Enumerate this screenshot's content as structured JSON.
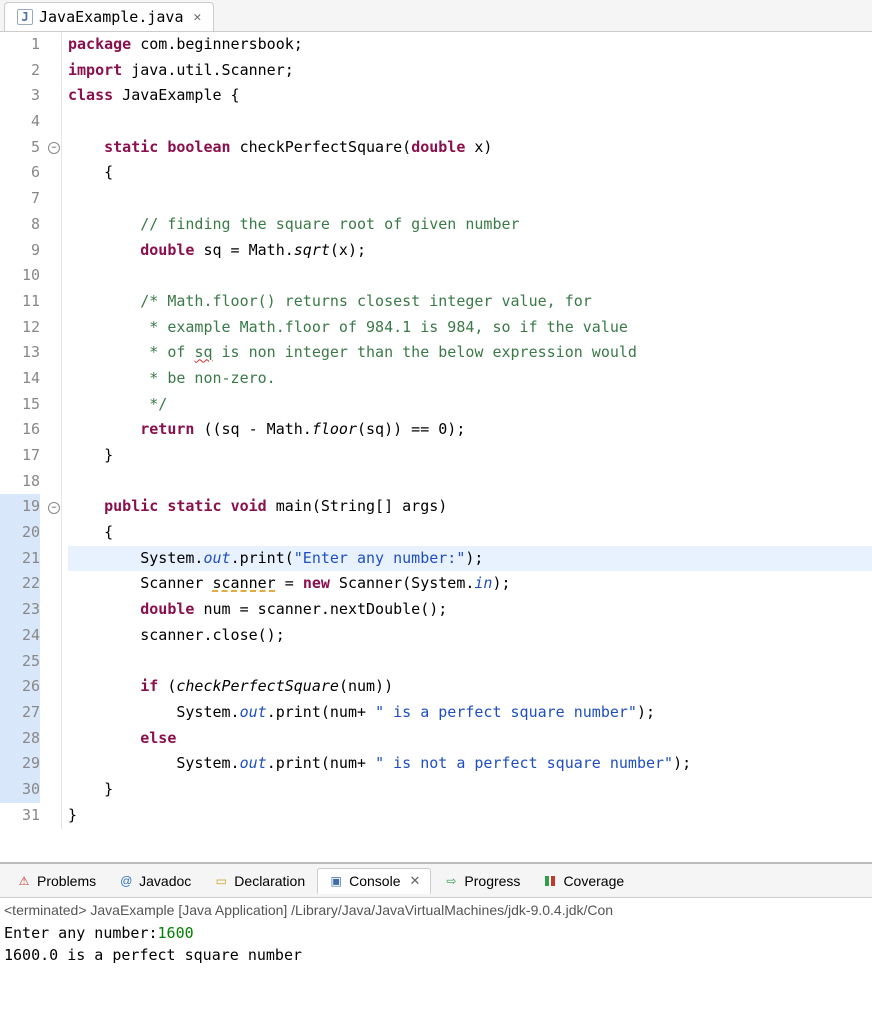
{
  "tab": {
    "filename": "JavaExample.java"
  },
  "code": {
    "lines": [
      {
        "n": 1,
        "tokens": [
          [
            "kw",
            "package"
          ],
          [
            "",
            " com.beginnersbook;"
          ]
        ]
      },
      {
        "n": 2,
        "tokens": [
          [
            "kw",
            "import"
          ],
          [
            "",
            " java.util.Scanner;"
          ]
        ]
      },
      {
        "n": 3,
        "tokens": [
          [
            "kw",
            "class"
          ],
          [
            "",
            " JavaExample {"
          ]
        ]
      },
      {
        "n": 4,
        "tokens": [
          [
            "",
            ""
          ]
        ]
      },
      {
        "n": 5,
        "fold": true,
        "tokens": [
          [
            "",
            "    "
          ],
          [
            "kw",
            "static"
          ],
          [
            "",
            " "
          ],
          [
            "kw",
            "boolean"
          ],
          [
            "",
            " checkPerfectSquare("
          ],
          [
            "kw",
            "double"
          ],
          [
            "",
            " x)"
          ]
        ]
      },
      {
        "n": 6,
        "tokens": [
          [
            "",
            "    {"
          ]
        ]
      },
      {
        "n": 7,
        "tokens": [
          [
            "",
            ""
          ]
        ]
      },
      {
        "n": 8,
        "tokens": [
          [
            "",
            "        "
          ],
          [
            "comment",
            "// finding the square root of given number"
          ]
        ]
      },
      {
        "n": 9,
        "tokens": [
          [
            "",
            "        "
          ],
          [
            "kw",
            "double"
          ],
          [
            "",
            " sq = Math."
          ],
          [
            "method-ital",
            "sqrt"
          ],
          [
            "",
            "(x);"
          ]
        ]
      },
      {
        "n": 10,
        "tokens": [
          [
            "",
            ""
          ]
        ]
      },
      {
        "n": 11,
        "tokens": [
          [
            "",
            "        "
          ],
          [
            "comment",
            "/* Math.floor() returns closest integer value, for"
          ]
        ]
      },
      {
        "n": 12,
        "tokens": [
          [
            "",
            "        "
          ],
          [
            "comment",
            " * example Math.floor of 984.1 is 984, so if the value"
          ]
        ]
      },
      {
        "n": 13,
        "tokens": [
          [
            "",
            "        "
          ],
          [
            "comment",
            " * of "
          ],
          [
            "comment squiggly",
            "sq"
          ],
          [
            "comment",
            " is non integer than the below expression would"
          ]
        ]
      },
      {
        "n": 14,
        "tokens": [
          [
            "",
            "        "
          ],
          [
            "comment",
            " * be non-zero."
          ]
        ]
      },
      {
        "n": 15,
        "tokens": [
          [
            "",
            "        "
          ],
          [
            "comment",
            " */"
          ]
        ]
      },
      {
        "n": 16,
        "tokens": [
          [
            "",
            "        "
          ],
          [
            "kw",
            "return"
          ],
          [
            "",
            " ((sq - Math."
          ],
          [
            "method-ital",
            "floor"
          ],
          [
            "",
            "(sq)) == 0);"
          ]
        ]
      },
      {
        "n": 17,
        "tokens": [
          [
            "",
            "    }"
          ]
        ]
      },
      {
        "n": 18,
        "tokens": [
          [
            "",
            ""
          ]
        ]
      },
      {
        "n": 19,
        "hl": true,
        "fold": true,
        "tokens": [
          [
            "",
            "    "
          ],
          [
            "kw",
            "public"
          ],
          [
            "",
            " "
          ],
          [
            "kw",
            "static"
          ],
          [
            "",
            " "
          ],
          [
            "kw",
            "void"
          ],
          [
            "",
            " main(String[] args)"
          ]
        ]
      },
      {
        "n": 20,
        "hl": true,
        "tokens": [
          [
            "",
            "    {"
          ]
        ]
      },
      {
        "n": 21,
        "hl": true,
        "current": true,
        "tokens": [
          [
            "",
            "        System."
          ],
          [
            "static-ital",
            "out"
          ],
          [
            "",
            ".print("
          ],
          [
            "str",
            "\"Enter any number:\""
          ],
          [
            "",
            ");"
          ]
        ]
      },
      {
        "n": 22,
        "hl": true,
        "tokens": [
          [
            "",
            "        Scanner "
          ],
          [
            "orange-dash",
            "scanner"
          ],
          [
            "",
            " = "
          ],
          [
            "kw",
            "new"
          ],
          [
            "",
            " Scanner(System."
          ],
          [
            "static-ital",
            "in"
          ],
          [
            "",
            ");"
          ]
        ]
      },
      {
        "n": 23,
        "hl": true,
        "tokens": [
          [
            "",
            "        "
          ],
          [
            "kw",
            "double"
          ],
          [
            "",
            " num = scanner.nextDouble();"
          ]
        ]
      },
      {
        "n": 24,
        "hl": true,
        "tokens": [
          [
            "",
            "        scanner.close();"
          ]
        ]
      },
      {
        "n": 25,
        "hl": true,
        "tokens": [
          [
            "",
            ""
          ]
        ]
      },
      {
        "n": 26,
        "hl": true,
        "tokens": [
          [
            "",
            "        "
          ],
          [
            "kw",
            "if"
          ],
          [
            "",
            " ("
          ],
          [
            "method-ital",
            "checkPerfectSquare"
          ],
          [
            "",
            "(num))"
          ]
        ]
      },
      {
        "n": 27,
        "hl": true,
        "tokens": [
          [
            "",
            "            System."
          ],
          [
            "static-ital",
            "out"
          ],
          [
            "",
            ".print(num+ "
          ],
          [
            "str",
            "\" is a perfect square number\""
          ],
          [
            "",
            ");"
          ]
        ]
      },
      {
        "n": 28,
        "hl": true,
        "tokens": [
          [
            "",
            "        "
          ],
          [
            "kw",
            "else"
          ]
        ]
      },
      {
        "n": 29,
        "hl": true,
        "tokens": [
          [
            "",
            "            System."
          ],
          [
            "static-ital",
            "out"
          ],
          [
            "",
            ".print(num+ "
          ],
          [
            "str",
            "\" is not a perfect square number\""
          ],
          [
            "",
            ");"
          ]
        ]
      },
      {
        "n": 30,
        "hl": true,
        "tokens": [
          [
            "",
            "    }"
          ]
        ]
      },
      {
        "n": 31,
        "tokens": [
          [
            "",
            "}"
          ]
        ]
      }
    ]
  },
  "bottom_tabs": {
    "problems": "Problems",
    "javadoc": "Javadoc",
    "declaration": "Declaration",
    "console": "Console",
    "progress": "Progress",
    "coverage": "Coverage"
  },
  "console": {
    "status": "<terminated> JavaExample [Java Application] /Library/Java/JavaVirtualMachines/jdk-9.0.4.jdk/Con",
    "prompt": "Enter any number:",
    "input": "1600",
    "output": "1600.0 is a perfect square number"
  }
}
